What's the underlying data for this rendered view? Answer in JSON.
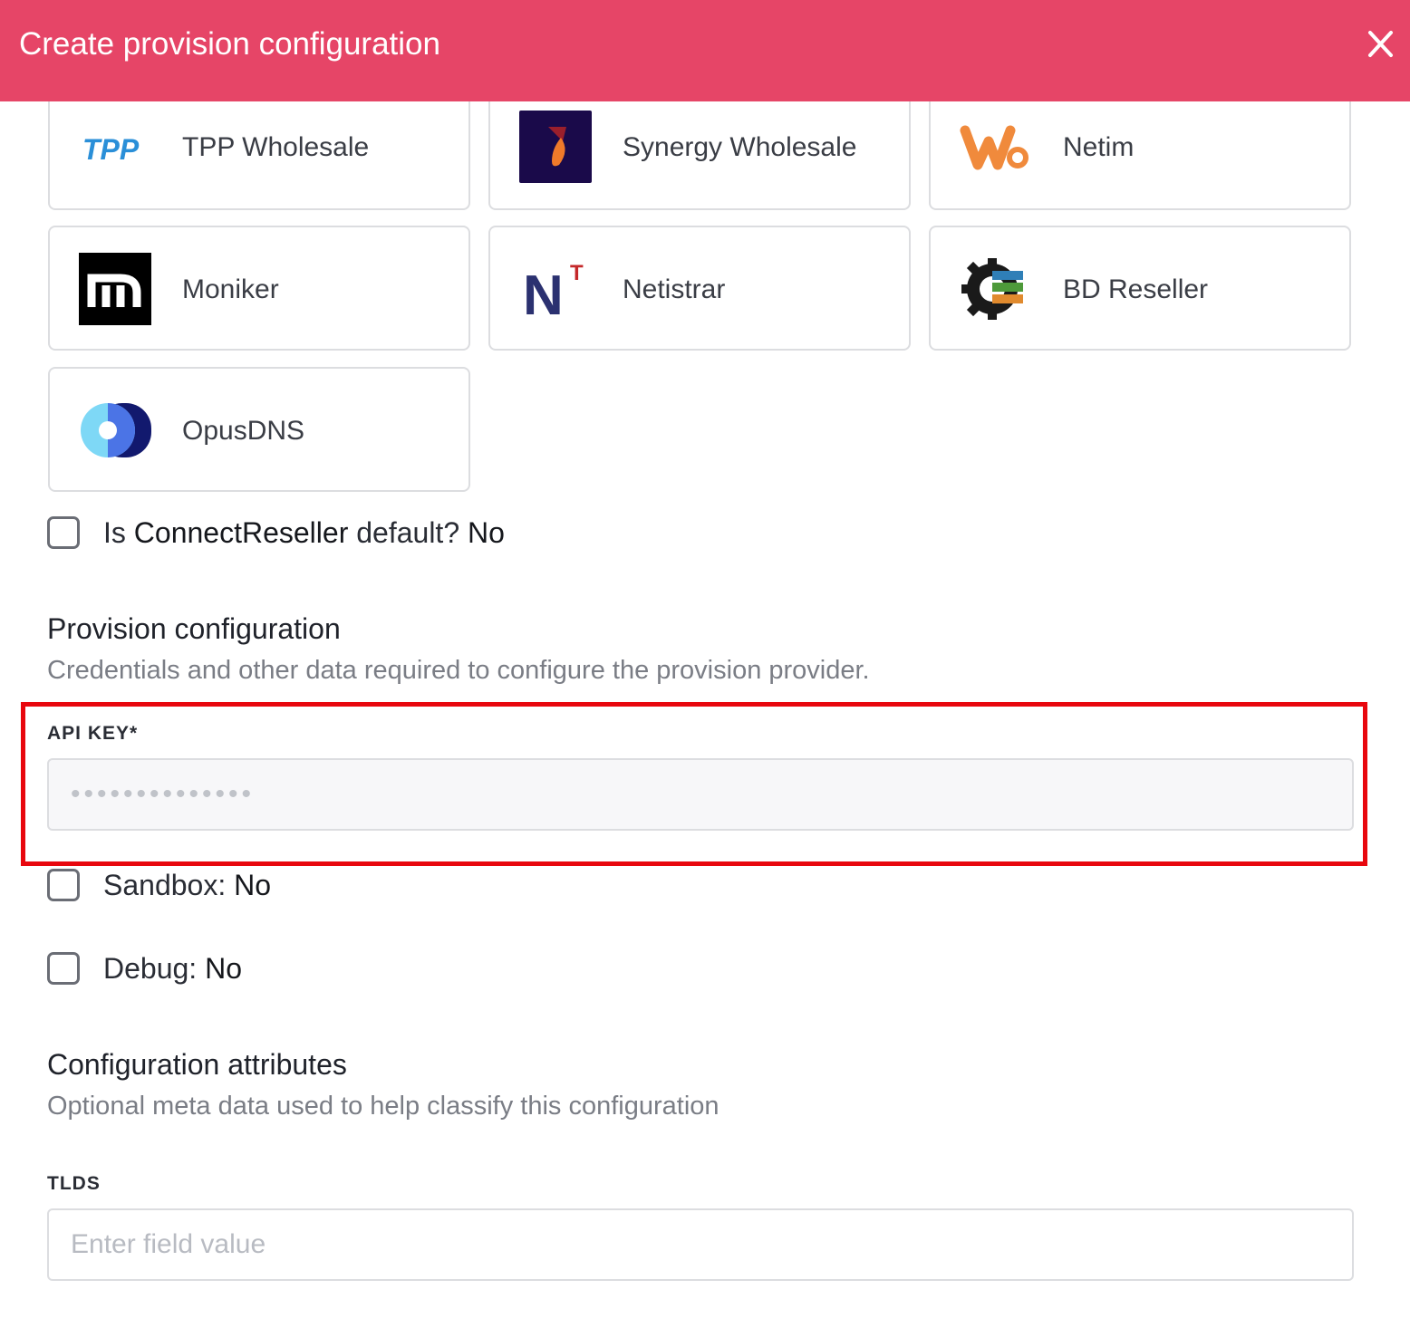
{
  "modal": {
    "title": "Create provision configuration"
  },
  "providers": [
    {
      "name": "TPP Wholesale",
      "logo_text": "TPP"
    },
    {
      "name": "Synergy Wholesale"
    },
    {
      "name": "Netim"
    },
    {
      "name": "Moniker"
    },
    {
      "name": "Netistrar",
      "logo_text": "N",
      "logo_sup": "T"
    },
    {
      "name": "BD Reseller"
    },
    {
      "name": "OpusDNS"
    }
  ],
  "default_toggle": {
    "prefix": "Is ",
    "provider": "ConnectReseller",
    "suffix": " default? ",
    "value": "No"
  },
  "provision_section": {
    "title": "Provision configuration",
    "description": "Credentials and other data required to configure the provision provider.",
    "api_key": {
      "label": "API KEY*",
      "placeholder": "••••••••••••••"
    },
    "sandbox": {
      "label": "Sandbox: ",
      "value": "No"
    },
    "debug": {
      "label": "Debug: ",
      "value": "No"
    }
  },
  "attributes_section": {
    "title": "Configuration attributes",
    "description": "Optional meta data used to help classify this configuration",
    "tlds": {
      "label": "TLDS",
      "placeholder": "Enter field value"
    }
  },
  "colors": {
    "header": "#e64567",
    "highlight": "#e8070e"
  }
}
